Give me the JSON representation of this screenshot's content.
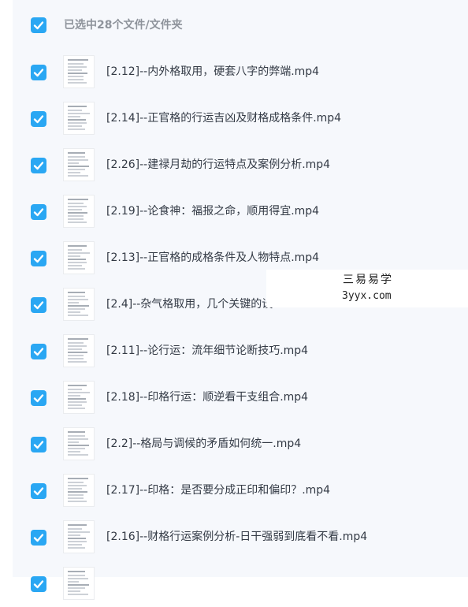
{
  "colors": {
    "checkbox": "#2aa7f3",
    "panel_bg": "#f6f8fc",
    "text": "#333a45",
    "header_text": "#8e939b"
  },
  "header": {
    "label": "已选中28个文件/文件夹",
    "checkbox_icon": "checked-checkbox-icon"
  },
  "files": [
    {
      "name": "[2.12]--内外格取用，硬套八字的弊端.mp4",
      "checked": true
    },
    {
      "name": "[2.14]--正官格的行运吉凶及财格成格条件.mp4",
      "checked": true
    },
    {
      "name": "[2.26]--建禄月劫的行运特点及案例分析.mp4",
      "checked": true
    },
    {
      "name": "[2.19]--论食神：福报之命，顺用得宜.mp4",
      "checked": true
    },
    {
      "name": "[2.13]--正官格的成格条件及人物特点.mp4",
      "checked": true
    },
    {
      "name": "[2.4]--杂气格取用，几个关键的设",
      "checked": true
    },
    {
      "name": "[2.11]--论行运：流年细节论断技巧.mp4",
      "checked": true
    },
    {
      "name": "[2.18]--印格行运：顺逆看干支组合.mp4",
      "checked": true
    },
    {
      "name": "[2.2]--格局与调候的矛盾如何统一.mp4",
      "checked": true
    },
    {
      "name": "[2.17]--印格：是否要分成正印和偏印？.mp4",
      "checked": true
    },
    {
      "name": "[2.16]--财格行运案例分析-日干强弱到底看不看.mp4",
      "checked": true
    },
    {
      "name": "",
      "checked": true
    }
  ],
  "watermark": {
    "line1": "三易易学",
    "line2": "3yyx.com"
  }
}
